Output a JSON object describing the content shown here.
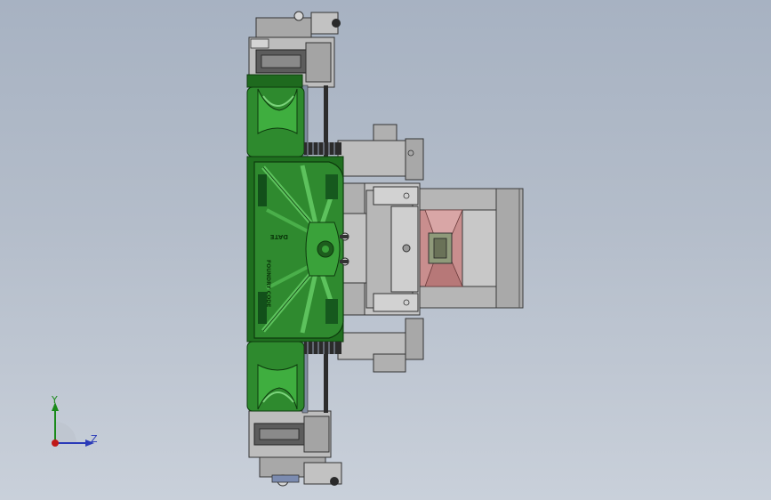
{
  "viewport": {
    "background_top": "#a7b2c2",
    "background_bottom": "#c9d0da"
  },
  "model": {
    "casting_text": {
      "date": "DATE",
      "foundry_code": "FOUNDRY CODE"
    },
    "colors": {
      "casting_green": "#2f8a2f",
      "casting_dark": "#0d4a12",
      "steel_gray": "#b3b3b3",
      "steel_dark": "#707070",
      "pink_block": "#c98e8e"
    }
  },
  "triad": {
    "y_label": "Y",
    "z_label": "Z",
    "y_color": "#1a8a1a",
    "z_color": "#2a3ab8",
    "origin_color": "#c01818"
  }
}
